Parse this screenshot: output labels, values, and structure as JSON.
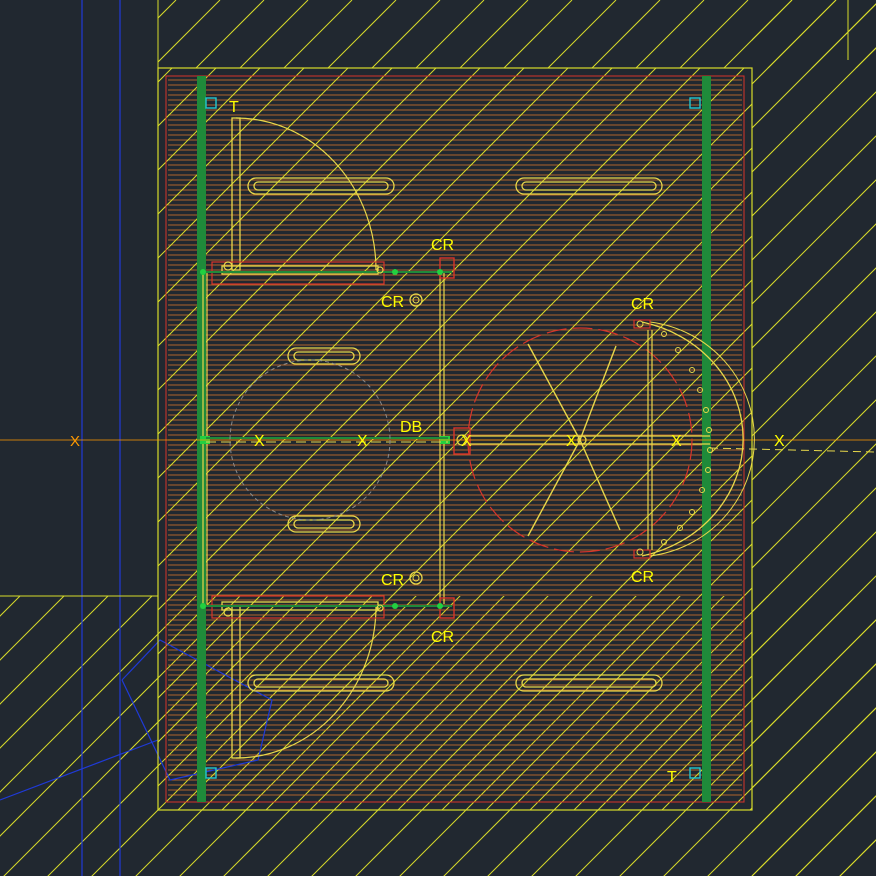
{
  "colors": {
    "background": "#212830",
    "hatch": "#d8dc2a",
    "slat": "#e0782a",
    "boundary_red": "#d8342a",
    "rail_green": "#1f8a3a",
    "door_yellow": "#e8d84a",
    "blue": "#1f3ad8",
    "cyan": "#22c8d0",
    "axis_orange": "#ff9900"
  },
  "labels": {
    "t_top": "T",
    "t_bottom": "T",
    "cr_top_right": "CR",
    "cr_top_left": "CR",
    "cr_bottom_left": "CR",
    "cr_bottom_right": "CR",
    "cr_revolving_top": "CR",
    "cr_revolving_bottom": "CR",
    "db": "DB",
    "axis_left": "X",
    "axis_right": "X",
    "x_marks": [
      "X",
      "X",
      "X",
      "X",
      "X"
    ]
  }
}
